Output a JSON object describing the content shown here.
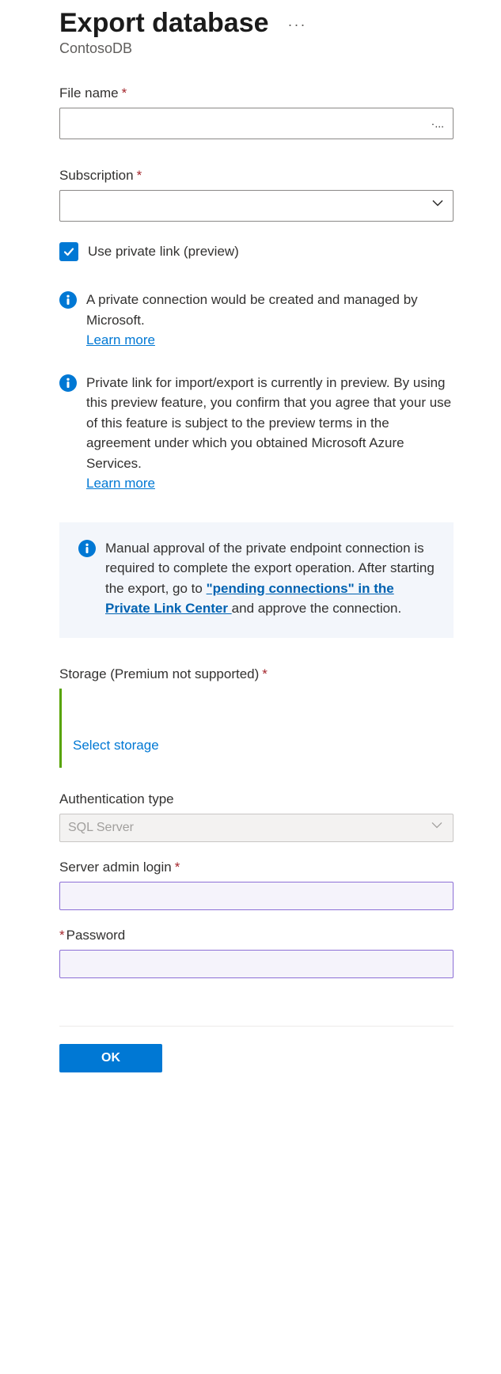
{
  "header": {
    "title": "Export database",
    "subtitle": "ContosoDB"
  },
  "fields": {
    "filename": {
      "label": "File name",
      "value": "",
      "suffix": "·..."
    },
    "subscription": {
      "label": "Subscription",
      "value": ""
    },
    "privateLink": {
      "label": "Use private link (preview)",
      "checked": true
    },
    "storage": {
      "label": "Storage (Premium not supported)",
      "selectText": "Select storage"
    },
    "authType": {
      "label": "Authentication type",
      "value": "SQL Server"
    },
    "adminLogin": {
      "label": "Server admin login",
      "value": ""
    },
    "password": {
      "label": "Password",
      "value": ""
    }
  },
  "info": {
    "private1": {
      "text": "A private connection would be created and managed by Microsoft.",
      "learn": "Learn more"
    },
    "private2": {
      "text": "Private link for import/export is currently in preview. By using this preview feature, you confirm that you agree that your use of this feature is subject to the preview terms in the agreement under which you obtained Microsoft Azure Services.",
      "learn": "Learn more"
    },
    "manual": {
      "pre": "Manual approval of the private endpoint connection is required to complete the export operation. After starting the export, go to ",
      "link": "\"pending connections\" in the Private Link Center ",
      "post": "and approve the connection."
    }
  },
  "footer": {
    "ok": "OK"
  }
}
